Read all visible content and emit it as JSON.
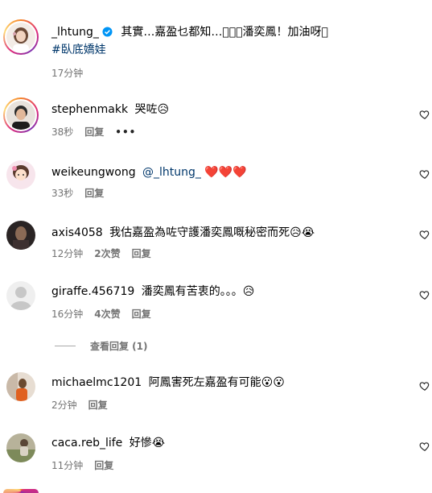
{
  "post": {
    "username": "_lhtung_",
    "text": "其實…嘉盈乜都知…\u0001\u0001\u0001潘奕鳳！加油呀\u0001",
    "text_display": "其實…嘉盈乜都知…􀀀􀀀􀀀潘奕鳳！加油呀􀀀",
    "hashtag": "#臥底嬌娃",
    "time": "17分钟"
  },
  "comments": [
    {
      "username": "stephenmakk",
      "text": "哭咗",
      "emoji": "😥",
      "time": "38秒",
      "likes": "",
      "reply": "回复",
      "more": "•••"
    },
    {
      "username": "weikeungwong",
      "mention": "@_lhtung_",
      "emoji": "❤️❤️❤️",
      "time": "33秒",
      "likes": "",
      "reply": "回复"
    },
    {
      "username": "axis4058",
      "text": "我估嘉盈為咗守護潘奕鳳嘅秘密而死",
      "emoji": "😥😭",
      "time": "12分钟",
      "likes": "2次赞",
      "reply": "回复"
    },
    {
      "username": "giraffe.456719",
      "text": "潘奕鳳有苦衷的。。。",
      "emoji": "😥",
      "time": "16分钟",
      "likes": "4次赞",
      "reply": "回复"
    },
    {
      "username": "michaelmc1201",
      "text": "阿鳳害死左嘉盈有可能",
      "emoji": "😮😮",
      "time": "2分钟",
      "likes": "",
      "reply": "回复"
    },
    {
      "username": "caca.reb_life",
      "text": "好慘",
      "emoji": "😭",
      "time": "11分钟",
      "likes": "",
      "reply": "回复"
    }
  ],
  "view_replies": "查看回复 (1)",
  "icons": {
    "heart": "heart-outline-icon",
    "verified": "verified-badge-icon"
  },
  "colors": {
    "link": "#00376b",
    "muted": "#737373",
    "verified": "#0095f6"
  }
}
